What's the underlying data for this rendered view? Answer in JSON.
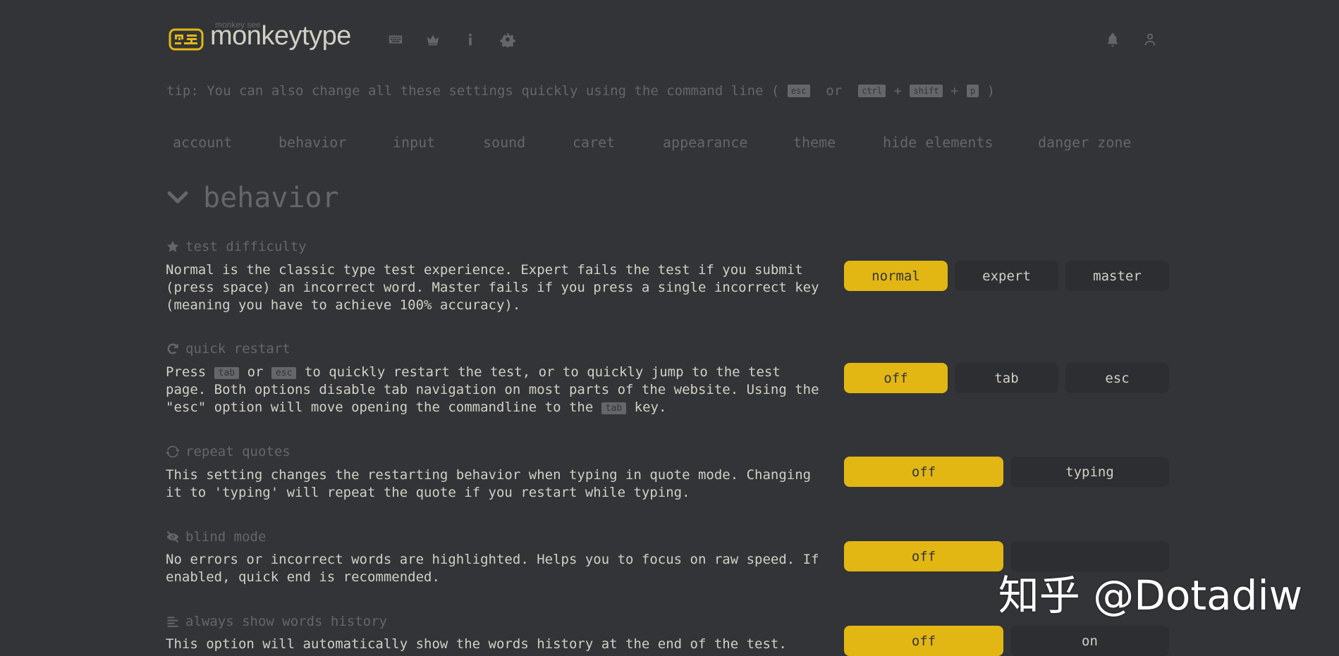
{
  "header": {
    "logo_small": "monkey see",
    "logo_text": "monkeytype",
    "nav_icons": [
      "keyboard-icon",
      "crown-icon",
      "info-icon",
      "gear-icon"
    ],
    "right_icons": [
      "bell-icon",
      "user-icon"
    ]
  },
  "tip": {
    "prefix": "tip: You can also change all these settings quickly using the command line (",
    "key_esc": "esc",
    "or": "or",
    "key_ctrl": "ctrl",
    "plus1": "+",
    "key_shift": "shift",
    "plus2": "+",
    "key_p": "p",
    "suffix": ")"
  },
  "tabs": [
    "account",
    "behavior",
    "input",
    "sound",
    "caret",
    "appearance",
    "theme",
    "hide elements",
    "danger zone"
  ],
  "section": {
    "title": "behavior"
  },
  "settings": [
    {
      "title": "test difficulty",
      "icon": "star-icon",
      "desc": "Normal is the classic type test experience. Expert fails the test if you submit (press space) an incorrect word. Master fails if you press a single incorrect key (meaning you have to achieve 100% accuracy).",
      "options": [
        "normal",
        "expert",
        "master"
      ],
      "active": "normal"
    },
    {
      "title": "quick restart",
      "icon": "redo-icon",
      "desc_parts": [
        "Press",
        "tab",
        "or",
        "esc",
        "to quickly restart the test, or to quickly jump to the test page. Both options disable tab navigation on most parts of the website. Using the \"esc\" option will move opening the commandline to the",
        "tab",
        "key."
      ],
      "options": [
        "off",
        "tab",
        "esc"
      ],
      "active": "off"
    },
    {
      "title": "repeat quotes",
      "icon": "sync-icon",
      "desc": "This setting changes the restarting behavior when typing in quote mode. Changing it to 'typing' will repeat the quote if you restart while typing.",
      "options": [
        "off",
        "typing"
      ],
      "active": "off"
    },
    {
      "title": "blind mode",
      "icon": "eye-slash-icon",
      "desc": "No errors or incorrect words are highlighted. Helps you to focus on raw speed. If enabled, quick end is recommended.",
      "options": [
        "off",
        ""
      ],
      "active": "off"
    },
    {
      "title": "always show words history",
      "icon": "align-left-icon",
      "desc": "This option will automatically show the words history at the end of the test.",
      "options": [
        "off",
        "on"
      ],
      "active": "off"
    }
  ],
  "watermark": "知乎 @Dotadiw",
  "colors": {
    "bg": "#323437",
    "main": "#e2b714",
    "sub": "#646669",
    "text": "#d1d0c5",
    "sub_alt": "#2c2e31"
  }
}
